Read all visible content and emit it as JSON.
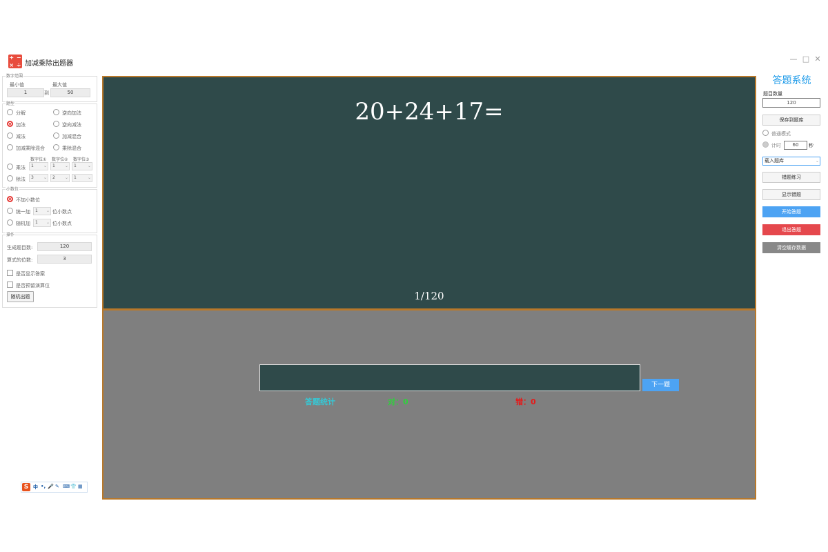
{
  "window": {
    "title": "加减乘除出题器",
    "icon_glyphs": [
      "+",
      "−",
      "×",
      "÷"
    ],
    "controls": [
      "minimize-icon",
      "maximize-icon",
      "close-icon"
    ]
  },
  "settings": {
    "range": {
      "legend": "数字范围",
      "min_label": "最小值",
      "max_label": "最大值",
      "min_value": "1",
      "to_label": "到",
      "max_value": "50"
    },
    "type": {
      "legend": "题型",
      "options": [
        "分解",
        "逆向加法",
        "加法",
        "逆向减法",
        "减法",
        "加减混合",
        "加减乘除混合",
        "乘除混合"
      ],
      "selected": "加法",
      "digit_headers": [
        "数字位①",
        "数字位②",
        "数字位③"
      ],
      "multiply_label": "乘法",
      "multiply_digits": [
        "1",
        "1",
        "1"
      ],
      "divide_label": "除法",
      "divide_digits": [
        "3",
        "2",
        "1"
      ]
    },
    "decimal": {
      "legend": "小数位",
      "no_decimal": "不加小数位",
      "unified_prefix": "统一加",
      "unified_value": "1",
      "unified_suffix": "位小数点",
      "random_prefix": "随机加",
      "random_value": "1",
      "random_suffix": "位小数点"
    },
    "operation": {
      "legend": "操作",
      "count_label": "生成题目数:",
      "count_value": "120",
      "digits_label": "算式的位数:",
      "digits_value": "3",
      "show_answer": "是否显示答案",
      "reserve_calc": "是否预留演算位",
      "random_button": "随机出题"
    }
  },
  "ime_toolbar": {
    "logo": "S",
    "items": [
      "中",
      "•,",
      "🎤",
      "✎",
      "⌨",
      "👕",
      "▦"
    ]
  },
  "board": {
    "question": "20+24+17=",
    "progress": "1/120"
  },
  "answer_area": {
    "next_button": "下一题",
    "stats_label": "答题统计",
    "correct": "对：0",
    "wrong": "错：0"
  },
  "sidebar": {
    "title": "答题系统",
    "count_label": "题目数量",
    "count_value": "120",
    "save_button": "保存到题库",
    "normal_mode": "普通模式",
    "timer_label": "计时",
    "timer_value": "60",
    "timer_unit": "秒",
    "load_select": "载入题库",
    "wrong_practice": "错题练习",
    "show_wrong": "显示错题",
    "start_button": "开始答题",
    "exit_button": "退出答题",
    "clear_button": "清空缓存数据"
  },
  "colors": {
    "board": "#2f4a4a",
    "frame": "#b8782a",
    "accent_blue": "#4da3f3",
    "title_blue": "#1e9be9",
    "stats_cyan": "#35c9d6",
    "correct_green": "#2ed13c",
    "wrong_red": "#e41a1a"
  }
}
